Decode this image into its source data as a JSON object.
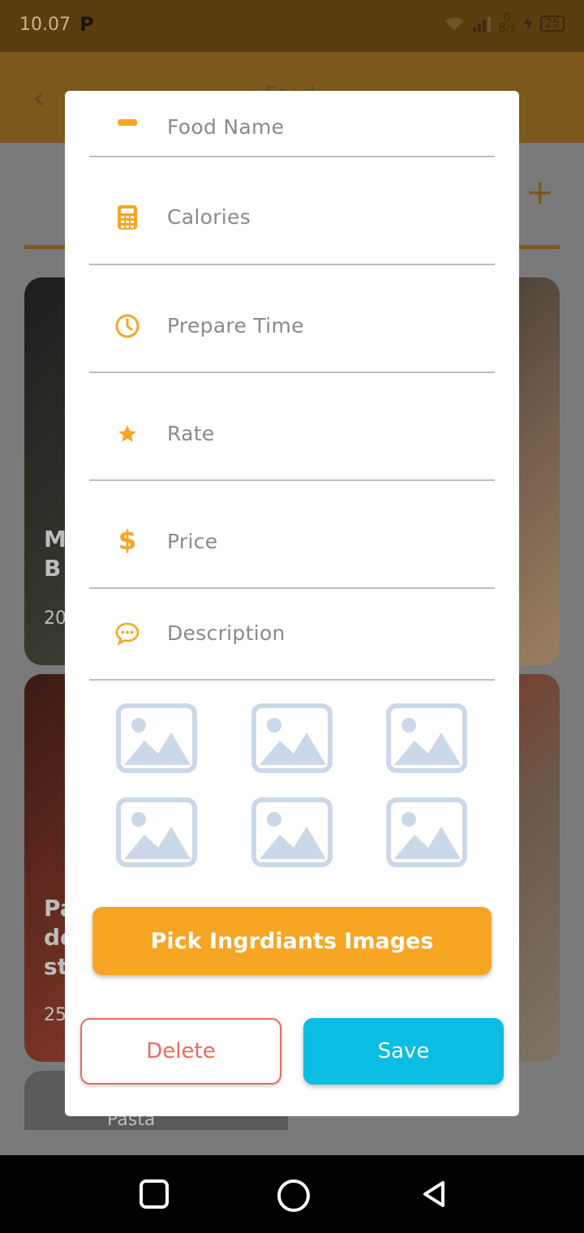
{
  "status_bar": {
    "time": "10.07",
    "carrier_icon": "P",
    "net_speed_value": "0",
    "net_speed_unit": "B/s",
    "battery": "25"
  },
  "app_bar": {
    "title": "Food"
  },
  "background_cards": [
    {
      "title_partial_1": "M",
      "title_partial_2": "B",
      "meta_partial": "20"
    },
    {
      "title_partial_1": "Pa",
      "title_partial_2": "de",
      "title_partial_3": "st",
      "meta_partial": "25"
    },
    {
      "title": "Pasta"
    }
  ],
  "dialog": {
    "fields": [
      {
        "icon": "food-icon",
        "placeholder": "Food Name"
      },
      {
        "icon": "calculator-icon",
        "placeholder": "Calories"
      },
      {
        "icon": "clock-icon",
        "placeholder": "Prepare Time"
      },
      {
        "icon": "star-icon",
        "placeholder": "Rate"
      },
      {
        "icon": "dollar-icon",
        "placeholder": "Price"
      },
      {
        "icon": "chat-icon",
        "placeholder": "Description"
      }
    ],
    "image_slots": 6,
    "pick_button_label": "Pick Ingrdiants Images",
    "delete_button_label": "Delete",
    "save_button_label": "Save"
  },
  "colors": {
    "accent": "#F6A623",
    "save": "#0BBDE3",
    "delete": "#EA6B5E",
    "placeholder_image": "#CBD8E8"
  }
}
